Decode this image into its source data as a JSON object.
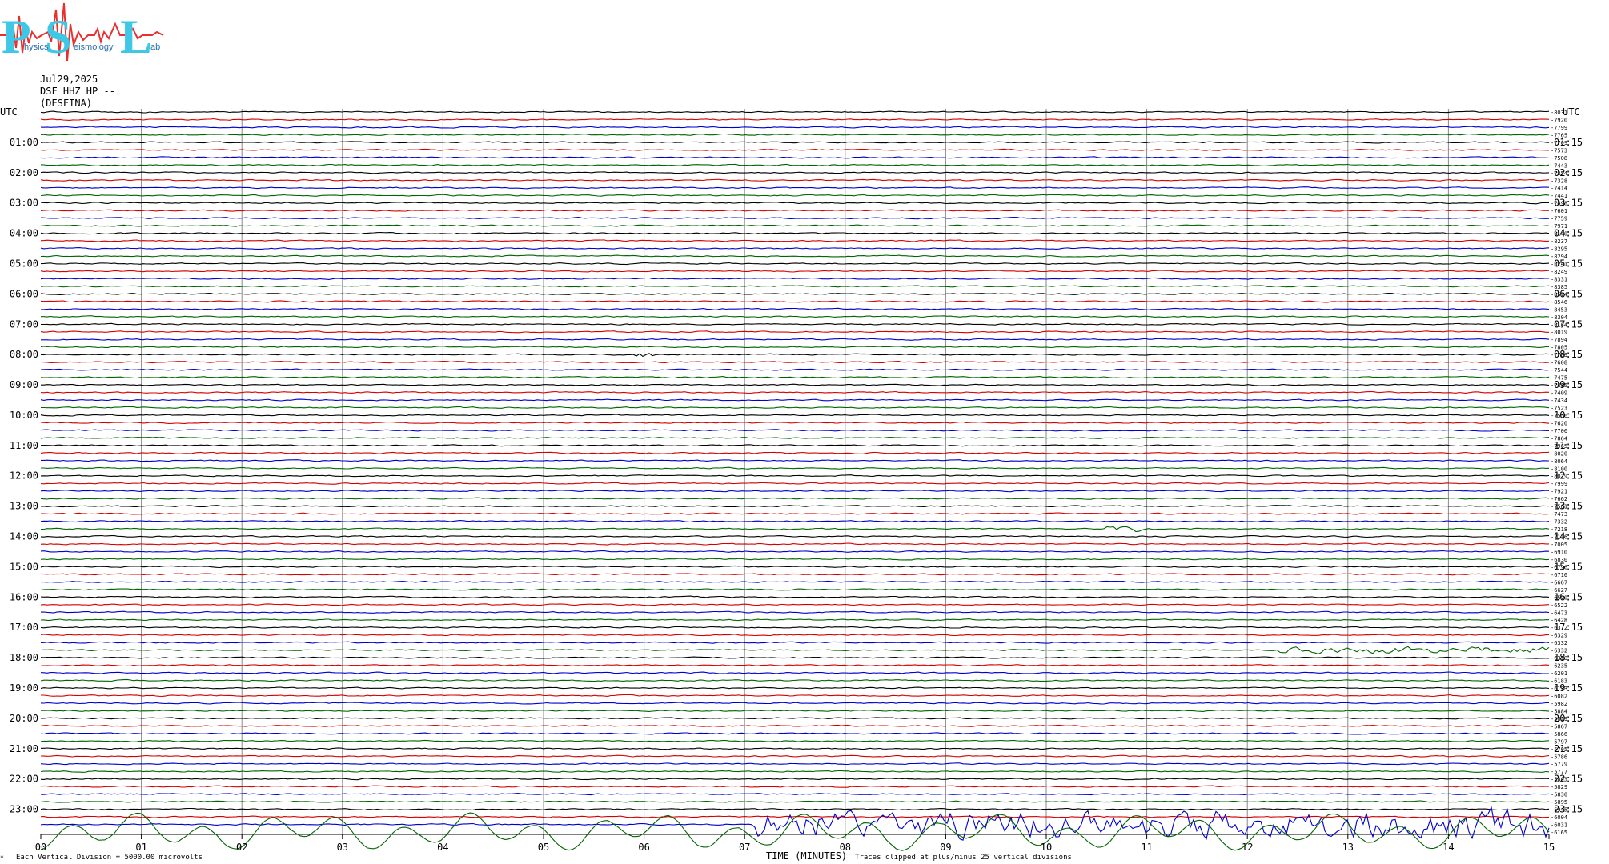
{
  "logo": {
    "big_letters": [
      "P",
      "S",
      "L"
    ],
    "small_words": [
      "hysics",
      "eismology",
      "ab"
    ]
  },
  "header": {
    "date": "Jul29,2025",
    "station": "DSF HHZ HP --",
    "site": "(DESFINA)"
  },
  "footer": {
    "marker": "*",
    "division_note": "Each Vertical Division = 5000.00 microvolts",
    "xlabel": "TIME (MINUTES)",
    "clip_note": "Traces clipped at plus/minus 25 vertical divisions"
  },
  "colors": {
    "trace_cycle": [
      "#000000",
      "#d40000",
      "#0000cc",
      "#006400"
    ],
    "grid": "#8a8a8a",
    "logo": "#3ec8e6",
    "logo_wave": "#e83030"
  },
  "chart_data": {
    "type": "line",
    "title": "",
    "left_axis_title": "UTC",
    "right_axis_title": "UTC",
    "left_hour_labels": [
      "01:00",
      "02:00",
      "03:00",
      "04:00",
      "05:00",
      "06:00",
      "07:00",
      "08:00",
      "09:00",
      "10:00",
      "11:00",
      "12:00",
      "13:00",
      "14:00",
      "15:00",
      "16:00",
      "17:00",
      "18:00",
      "19:00",
      "20:00",
      "21:00",
      "22:00",
      "23:00"
    ],
    "right_hour_labels": [
      "01:15",
      "02:15",
      "03:15",
      "04:15",
      "05:15",
      "06:15",
      "07:15",
      "08:15",
      "09:15",
      "10:15",
      "11:15",
      "12:15",
      "13:15",
      "14:15",
      "15:15",
      "16:15",
      "17:15",
      "18:15",
      "19:15",
      "20:15",
      "21:15",
      "22:15",
      "23:15"
    ],
    "x_ticks": [
      "00",
      "01",
      "02",
      "03",
      "04",
      "05",
      "06",
      "07",
      "08",
      "09",
      "10",
      "11",
      "12",
      "13",
      "14",
      "15"
    ],
    "xlim": [
      0,
      15
    ],
    "rows_per_hour": 4,
    "row_offsets": [
      "-8031",
      "-7920",
      "-7799",
      "-7765",
      "-7709",
      "-7573",
      "-7508",
      "-7443",
      "-7354",
      "-7328",
      "-7414",
      "-7441",
      "-7498",
      "-7601",
      "-7759",
      "-7971",
      "-8140",
      "-8237",
      "-8295",
      "-8294",
      "-8241",
      "-8249",
      "-8331",
      "-8385",
      "-8574",
      "-8546",
      "-8453",
      "-8304",
      "-8164",
      "-8019",
      "-7894",
      "-7805",
      "-7709",
      "-7608",
      "-7544",
      "-7475",
      "-7415",
      "-7409",
      "-7434",
      "-7523",
      "-7556",
      "-7620",
      "-7706",
      "-7864",
      "-7965",
      "-8020",
      "-8064",
      "-8100",
      "-8029",
      "-7999",
      "-7921",
      "-7662",
      "-7561",
      "-7473",
      "-7332",
      "-7218",
      "-7116",
      "-7005",
      "-6910",
      "-6830",
      "-6796",
      "-6710",
      "-6667",
      "-6627",
      "-6570",
      "-6522",
      "-6473",
      "-6428",
      "-6372",
      "-6329",
      "-6332",
      "-6332",
      "-6310",
      "-6235",
      "-6201",
      "-6183",
      "-6123",
      "-6082",
      "-5982",
      "-5884",
      "-5819",
      "-5867",
      "-5866",
      "-5797",
      "-5705",
      "-5786",
      "-5779",
      "-5777",
      "-5803",
      "-5829",
      "-5830",
      "-5895",
      "-5945",
      "-6004",
      "-6031",
      "-6165"
    ],
    "events": [
      {
        "row": 32,
        "minute_start": 5.85,
        "minute_end": 6.1,
        "amplitude": "small"
      },
      {
        "row": 55,
        "minute_start": 10.55,
        "minute_end": 10.95,
        "amplitude": "small"
      },
      {
        "row": 71,
        "minute_start": 12.3,
        "minute_end": 15.0,
        "amplitude": "small"
      },
      {
        "row": 94,
        "minute_start": 7.1,
        "minute_end": 15.0,
        "amplitude": "large"
      },
      {
        "row": 95,
        "minute_start": 0.0,
        "minute_end": 15.0,
        "amplitude": "clipped"
      }
    ]
  }
}
